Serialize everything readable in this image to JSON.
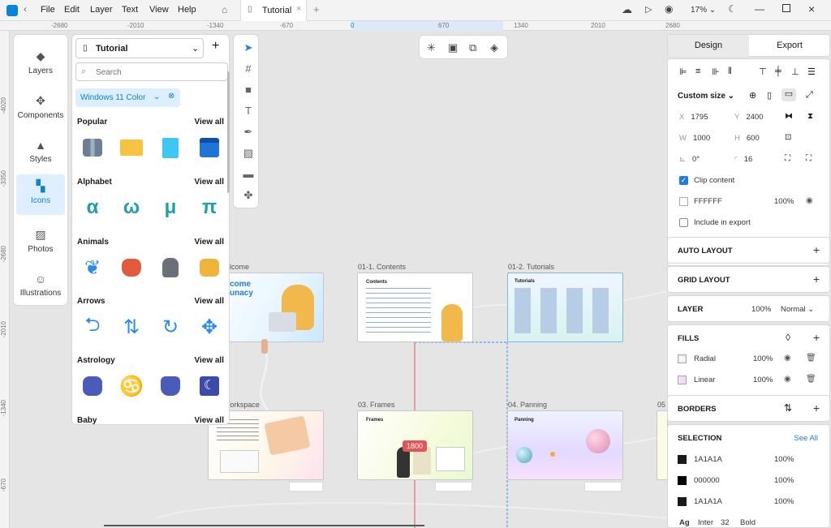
{
  "title_bar": {
    "menus": [
      "File",
      "Edit",
      "Layer",
      "Text",
      "View",
      "Help"
    ],
    "tab_label": "Tutorial",
    "zoom": "17%"
  },
  "ruler": {
    "top_ticks": [
      "-2680",
      "-2010",
      "-1340",
      "-670",
      "0",
      "670",
      "1340",
      "2010",
      "2680"
    ],
    "left_ticks": [
      "-4020",
      "-3350",
      "-2680",
      "-2010",
      "-1340",
      "-670"
    ]
  },
  "left_sidebar": {
    "items": [
      "Layers",
      "Components",
      "Styles",
      "Icons",
      "Photos",
      "Illustrations"
    ]
  },
  "icons_panel": {
    "file_name": "Tutorial",
    "search_placeholder": "Search",
    "filter_chip": "Windows 11 Color",
    "view_all": "View all",
    "sections": [
      "Popular",
      "Alphabet",
      "Animals",
      "Arrows",
      "Astrology",
      "Baby"
    ],
    "alphabet_glyphs": [
      "α",
      "ω",
      "μ",
      "π"
    ]
  },
  "canvas": {
    "frames": [
      {
        "label": "elcome",
        "text": "come unacy"
      },
      {
        "label": "01-1. Contents",
        "text": "Contents"
      },
      {
        "label": "01-2. Tutorials",
        "text": "Tutorials"
      },
      {
        "label": "Workspace",
        "text": ""
      },
      {
        "label": "03. Frames",
        "text": "Frames"
      },
      {
        "label": "04. Panning",
        "text": "Panning"
      },
      {
        "label": "05",
        "text": ""
      }
    ],
    "measure_badge": "1800"
  },
  "design_panel": {
    "tabs": [
      "Design",
      "Export"
    ],
    "size_preset": "Custom size",
    "x": "1795",
    "y": "2400",
    "w": "1000",
    "h": "600",
    "rotation": "0°",
    "radius": "16",
    "clip_content_label": "Clip content",
    "fill_hex": "FFFFFF",
    "fill_opacity": "100%",
    "include_export": "Include in export",
    "auto_layout": "AUTO LAYOUT",
    "grid_layout": "GRID LAYOUT",
    "layer": {
      "title": "LAYER",
      "opacity": "100%",
      "blend": "Normal"
    },
    "fills": {
      "title": "FILLS",
      "items": [
        {
          "name": "Radial",
          "opacity": "100%"
        },
        {
          "name": "Linear",
          "opacity": "100%"
        }
      ]
    },
    "borders": "BORDERS",
    "selection": {
      "title": "SELECTION",
      "see_all": "See All",
      "colors": [
        {
          "hex": "1A1A1A",
          "opacity": "100%"
        },
        {
          "hex": "000000",
          "opacity": "100%"
        },
        {
          "hex": "1A1A1A",
          "opacity": "100%"
        }
      ],
      "font": {
        "ag": "Ag",
        "family": "Inter",
        "size": "32",
        "weight": "Bold"
      }
    }
  }
}
